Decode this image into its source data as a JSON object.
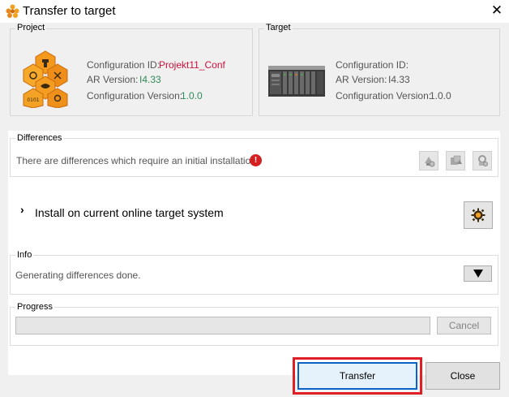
{
  "window": {
    "title": "Transfer to target",
    "close_symbol": "✕"
  },
  "project": {
    "group_label": "Project",
    "config_id_label": "Configuration ID:",
    "config_id_value": "Projekt11_Config",
    "ar_version_label": "AR Version:",
    "ar_version_value": "I4.33",
    "config_version_label": "Configuration Version:",
    "config_version_value": "1.0.0"
  },
  "target": {
    "group_label": "Target",
    "config_id_label": "Configuration ID:",
    "ar_version_label": "AR Version:",
    "ar_version_value": "I4.33",
    "config_version_label": "Configuration Version:",
    "config_version_value": "1.0.0"
  },
  "differences": {
    "group_label": "Differences",
    "message": "There are differences which require an initial installation.",
    "warning_symbol": "!"
  },
  "install": {
    "chevron": "›",
    "label": "Install on current online target system"
  },
  "info": {
    "group_label": "Info",
    "message": "Generating differences done."
  },
  "progress": {
    "group_label": "Progress",
    "value": 0,
    "cancel_label": "Cancel"
  },
  "buttons": {
    "transfer_label": "Transfer",
    "close_label": "Close"
  },
  "colors": {
    "project_config_id": "#d0103a",
    "project_values": "#2e8b57",
    "target_values": "#555555",
    "highlight_border": "#e01e25",
    "focus_border": "#0a64c8",
    "warning": "#d42020"
  }
}
